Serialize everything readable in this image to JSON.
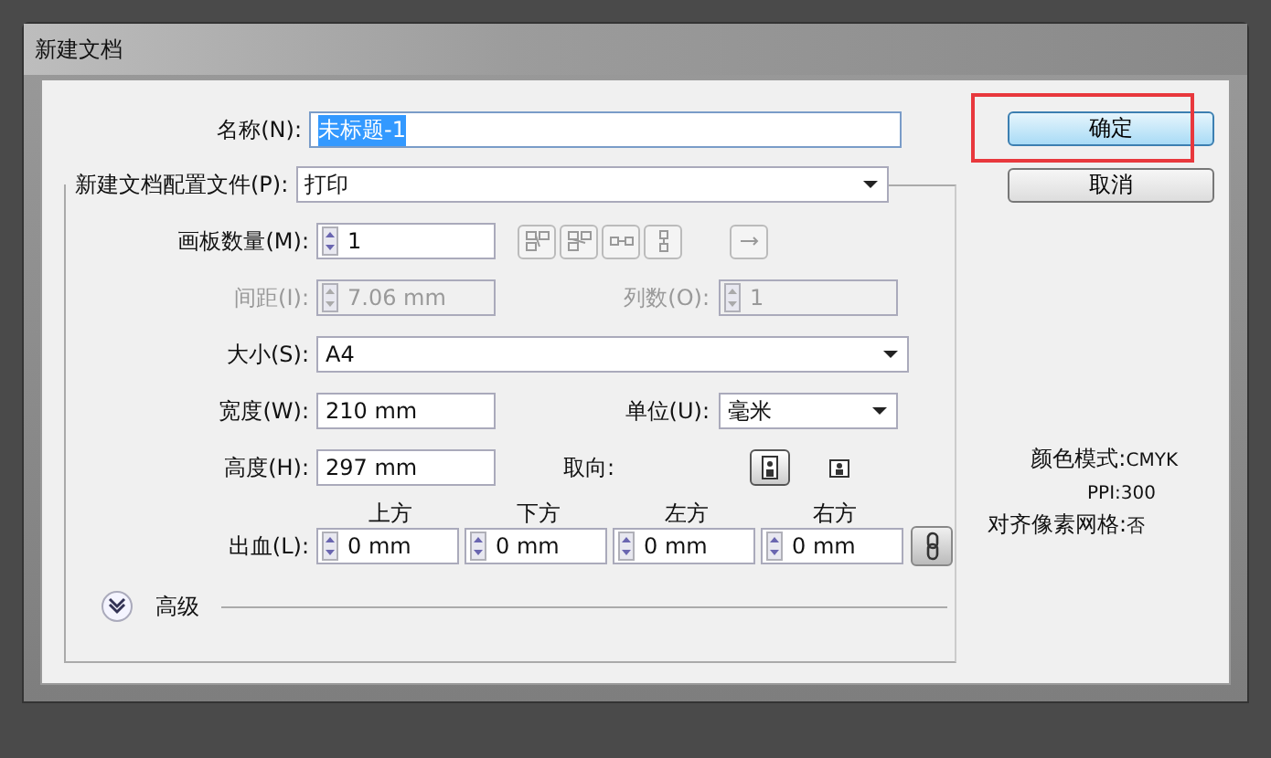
{
  "window": {
    "title": "新建文档"
  },
  "name_field": {
    "label": "名称(N):",
    "value": "未标题-1",
    "text_selected": true
  },
  "profile": {
    "label": "新建文档配置文件(P):",
    "value": "打印"
  },
  "artboards": {
    "label": "画板数量(M):",
    "value": "1"
  },
  "spacing": {
    "label": "间距(I):",
    "value": "7.06 mm",
    "disabled": true
  },
  "columns": {
    "label": "列数(O):",
    "value": "1",
    "disabled": true
  },
  "size": {
    "label": "大小(S):",
    "value": "A4"
  },
  "width": {
    "label": "宽度(W):",
    "value": "210 mm"
  },
  "units": {
    "label": "单位(U):",
    "value": "毫米"
  },
  "height": {
    "label": "高度(H):",
    "value": "297 mm"
  },
  "orientation": {
    "label": "取向:",
    "options": [
      {
        "kind": "portrait",
        "selected": true
      },
      {
        "kind": "landscape",
        "selected": false
      }
    ]
  },
  "bleed": {
    "label": "出血(L):",
    "linked": true,
    "sides": [
      {
        "label": "上方",
        "value": "0 mm"
      },
      {
        "label": "下方",
        "value": "0 mm"
      },
      {
        "label": "左方",
        "value": "0 mm"
      },
      {
        "label": "右方",
        "value": "0 mm"
      }
    ]
  },
  "advanced": {
    "label": "高级",
    "expanded": false
  },
  "buttons": [
    {
      "label": "确定",
      "default": true,
      "highlighted": true
    },
    {
      "label": "取消",
      "default": false,
      "highlighted": false
    }
  ],
  "info": [
    {
      "label": "颜色模式:",
      "value": "CMYK"
    },
    {
      "label": "PPI:",
      "value": "300"
    },
    {
      "label": "对齐像素网格:",
      "value": "否"
    }
  ]
}
